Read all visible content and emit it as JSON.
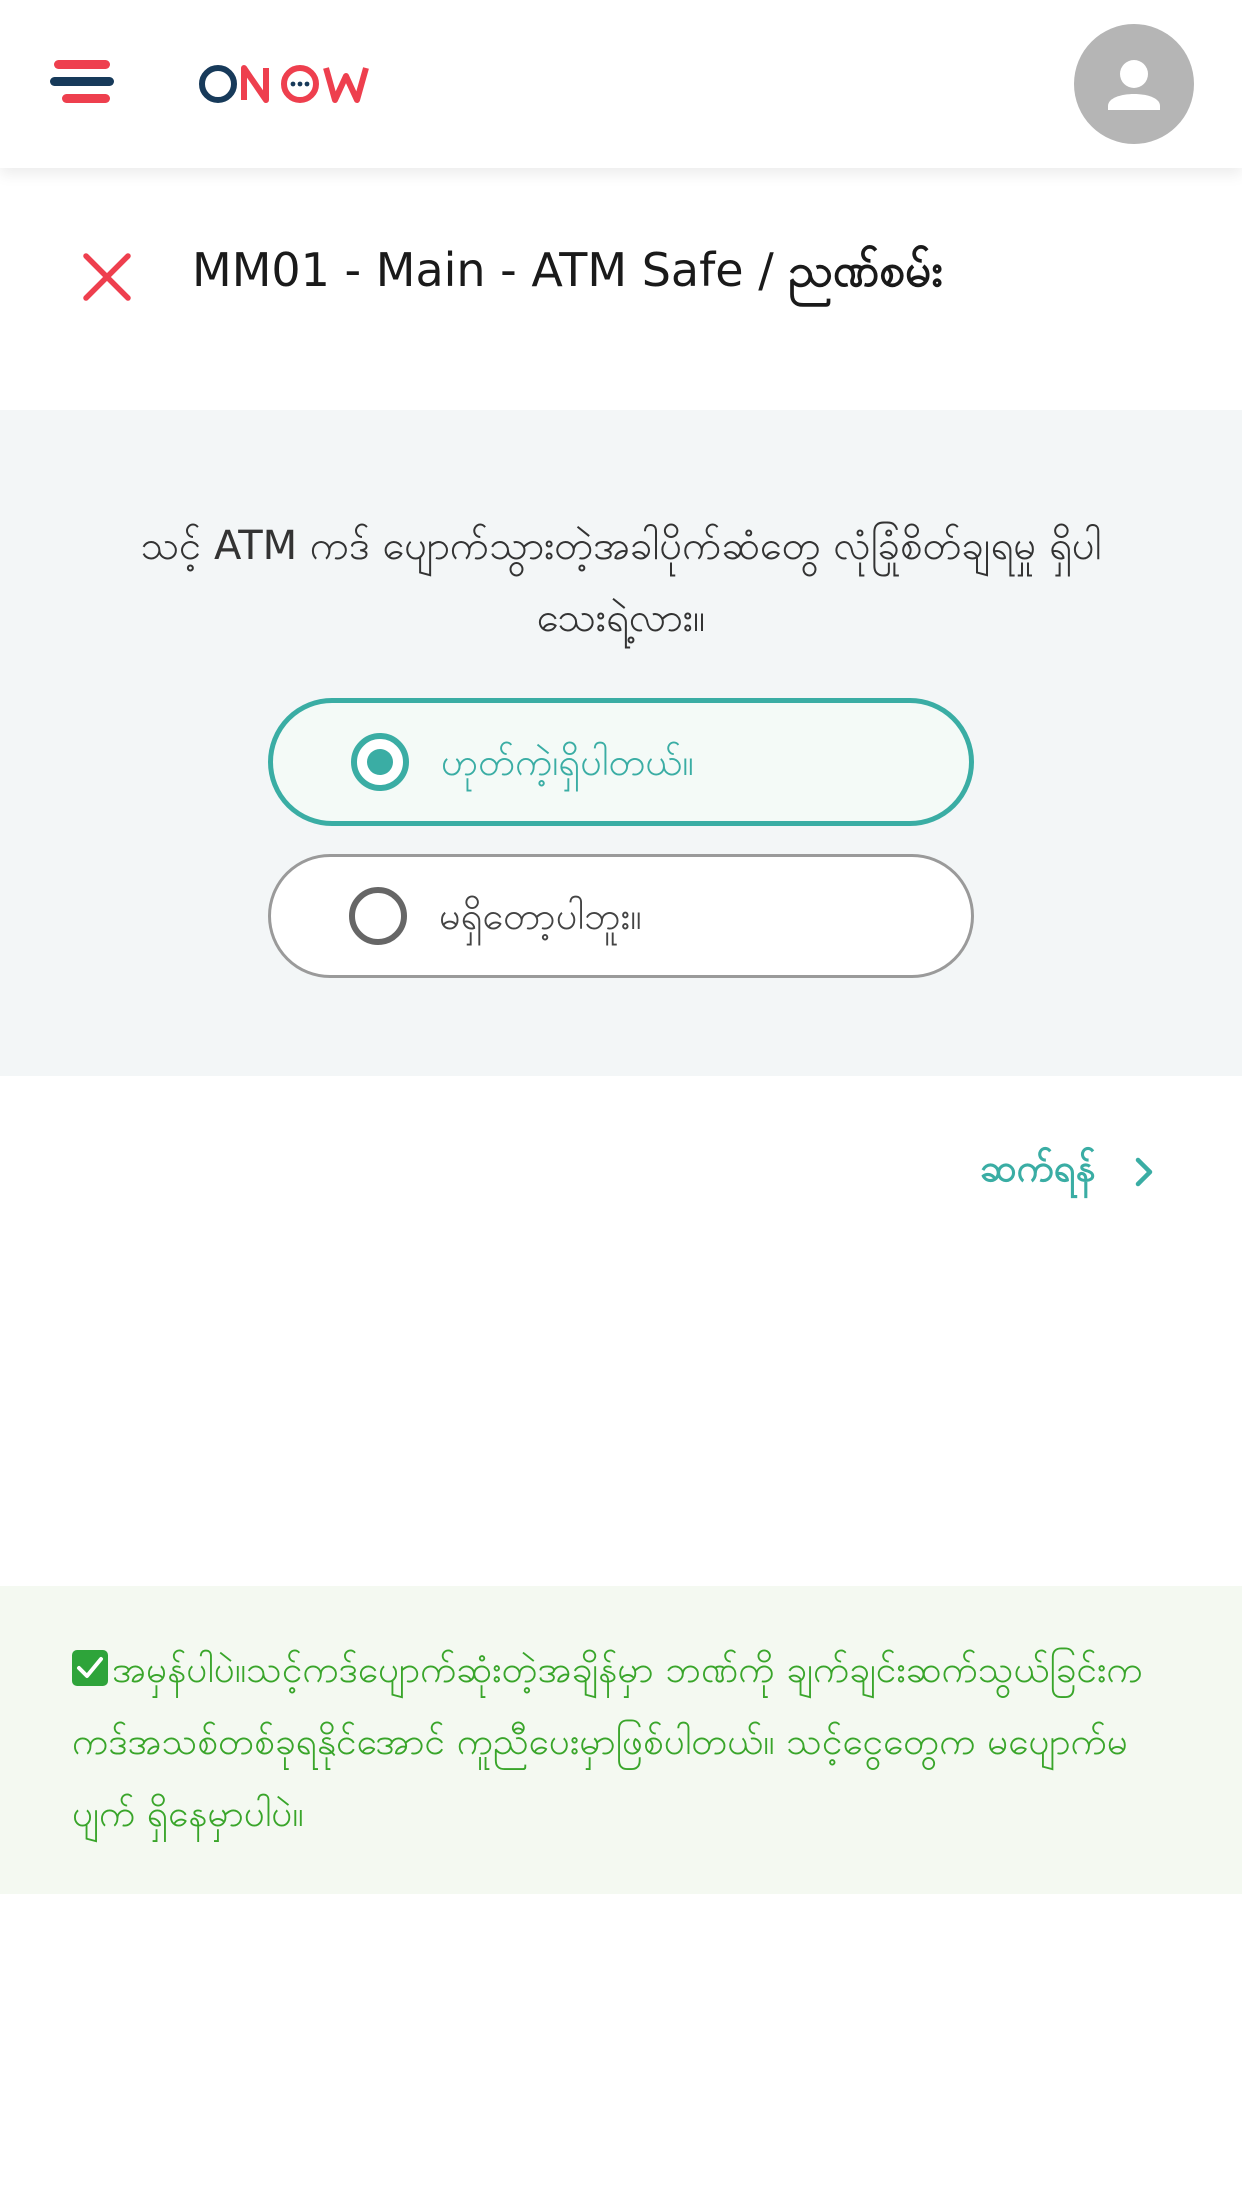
{
  "header": {
    "logo_text": "ONOW",
    "menu_icon": "hamburger-menu-icon",
    "avatar_icon": "user-avatar-icon"
  },
  "title_row": {
    "close_icon": "close-icon",
    "title_plain": "MM01 - Main - ATM Safe / ",
    "title_bold": "ညဏ်စမ်း"
  },
  "question": {
    "text": "သင့် ATM ကဒ် ပျောက်သွားတဲ့အခါပိုက်ဆံတွေ လုံခြုံစိတ်ချရမှု ရှိပါသေးရဲ့လား။",
    "options": [
      {
        "label": "ဟုတ်ကဲ့၊ရှိပါတယ်။",
        "selected": true
      },
      {
        "label": "မရှိတော့ပါဘူး။",
        "selected": false
      }
    ]
  },
  "next": {
    "label": "ဆက်ရန်",
    "icon": "chevron-right-icon"
  },
  "info": {
    "check_icon": "check-box-icon",
    "text": "အမှန်ပါပဲ။သင့်ကဒ်ပျောက်ဆုံးတဲ့အချိန်မှာ ဘဏ်ကို ချက်ချင်းဆက်သွယ်ခြင်းက ကဒ်အသစ်တစ်ခုရနိုင်အောင် ကူညီပေးမှာဖြစ်ပါတယ်။ သင့်ငွေတွေက မပျောက်မပျက် ရှိနေမှာပါပဲ။"
  },
  "colors": {
    "accent": "#3aada4",
    "brand_red": "#ee3f4e",
    "brand_navy": "#173a5a",
    "success_green": "#39a52a",
    "panel_bg": "#f3f6f7",
    "info_bg": "#f4f9f1"
  }
}
